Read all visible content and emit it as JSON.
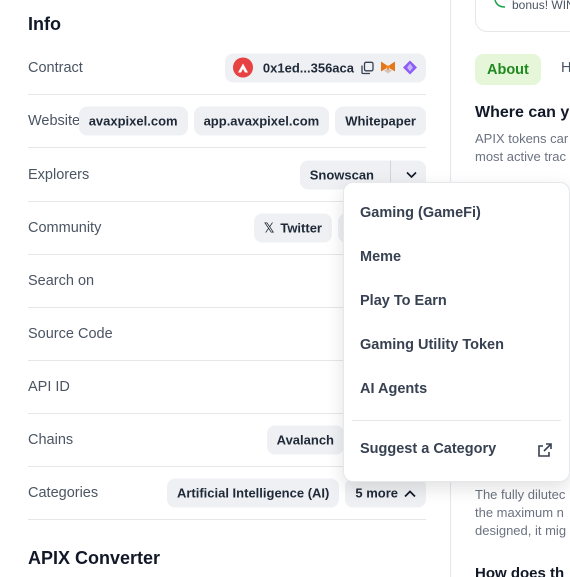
{
  "info": {
    "title": "Info",
    "contract": {
      "label": "Contract",
      "address": "0x1ed...356aca",
      "icons": [
        "avalanche-icon",
        "copy-icon",
        "metamask-icon",
        "purple-gem-icon"
      ]
    },
    "website": {
      "label": "Website",
      "links": [
        "avaxpixel.com",
        "app.avaxpixel.com",
        "Whitepaper"
      ]
    },
    "explorers": {
      "label": "Explorers",
      "selected": "Snowscan"
    },
    "community": {
      "label": "Community",
      "links": [
        "Twitter"
      ]
    },
    "search_on": {
      "label": "Search on"
    },
    "source_code": {
      "label": "Source Code"
    },
    "api_id": {
      "label": "API ID"
    },
    "chains": {
      "label": "Chains",
      "value": "Avalanch"
    },
    "categories": {
      "label": "Categories",
      "first": "Artificial Intelligence (AI)",
      "more": "5 more"
    }
  },
  "converter": {
    "title": "APIX Converter"
  },
  "dropdown": {
    "items": [
      "Gaming (GameFi)",
      "Meme",
      "Play To Earn",
      "Gaming Utility Token",
      "AI Agents"
    ],
    "suggest": "Suggest a Category"
  },
  "right": {
    "bonus_text": "bonus! WIN",
    "tabs": {
      "about": "About",
      "other": "H"
    },
    "where_title": "Where can y",
    "para1": [
      "APIX tokens car",
      "most active trac"
    ],
    "para2": [
      "The fully dilutec",
      "the maximum n",
      "designed, it mig"
    ],
    "how_title": "How does th"
  },
  "colors": {
    "about_bg": "#e6f7d9",
    "about_text": "#1f8a1f",
    "avax_red": "#e84142"
  }
}
